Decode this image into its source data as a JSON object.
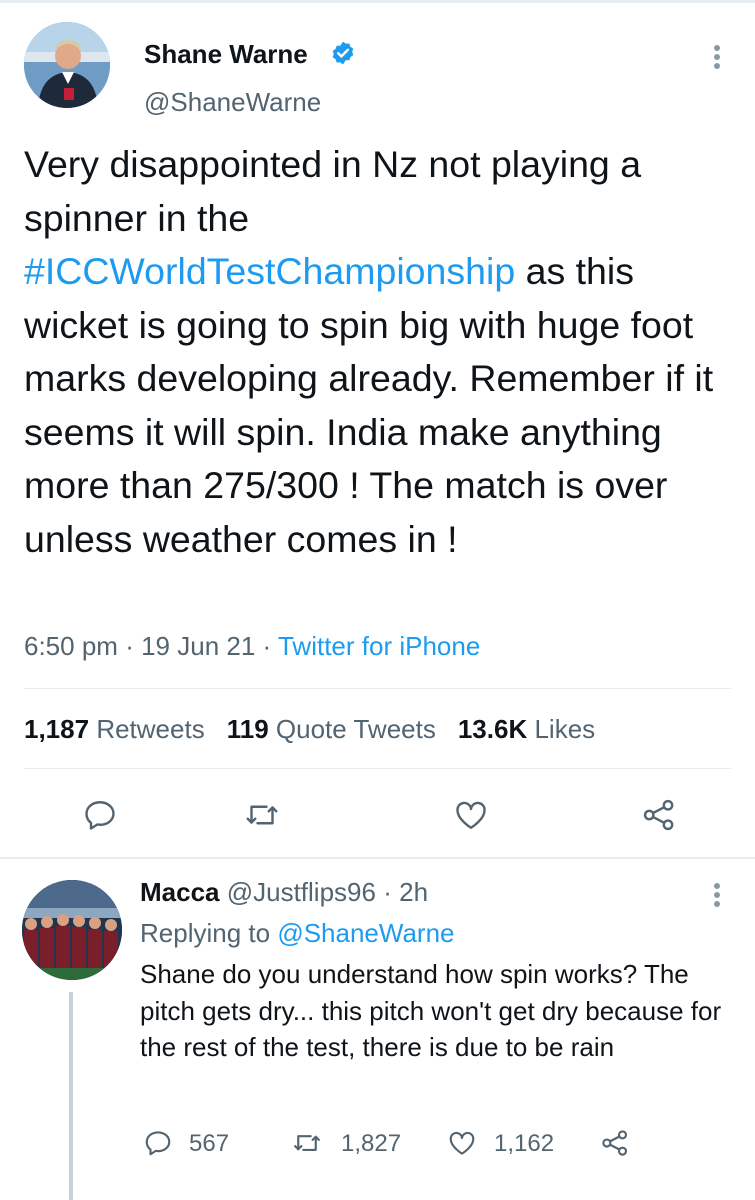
{
  "tweet": {
    "author_name": "Shane Warne",
    "author_handle": "@ShaneWarne",
    "text_before": "Very disappointed in Nz not playing a spinner in the",
    "hashtag": "#ICCWorldTestChampionship",
    "text_after": "as this wicket is going to spin big with huge foot marks developing already. Remember if it seems it will spin. India make anything more than 275/300 ! The match is over unless weather comes in !",
    "time": "6:50 pm",
    "date": "19 Jun 21",
    "source": "Twitter for iPhone",
    "separator": "·",
    "stats": {
      "retweets_count": "1,187",
      "retweets_label": "Retweets",
      "quotes_count": "119",
      "quotes_label": "Quote Tweets",
      "likes_count": "13.6K",
      "likes_label": "Likes"
    }
  },
  "reply": {
    "author_name": "Macca",
    "author_handle": "@Justflips96",
    "age": "2h",
    "replying_label": "Replying to",
    "replying_handle": "@ShaneWarne",
    "text": "Shane do you understand how spin works? The pitch gets dry... this pitch won't get dry because for the rest of the test, there is due to be rain",
    "replies": "567",
    "retweets": "1,827",
    "likes": "1,162"
  },
  "colors": {
    "link": "#1d9bf0",
    "secondary_text": "#536471",
    "divider": "#e6ecf0"
  }
}
